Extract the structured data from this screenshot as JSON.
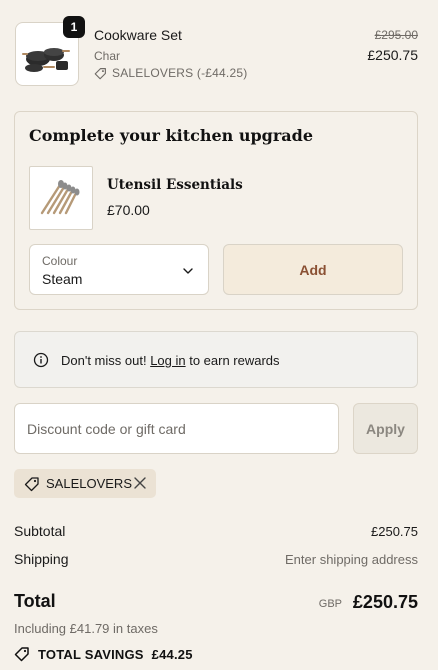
{
  "product": {
    "quantity": "1",
    "name": "Cookware Set",
    "variant": "Char",
    "discount_line": "SALELOVERS (-£44.25)",
    "original_price": "£295.00",
    "price": "£250.75",
    "image_icon": "cookware-image"
  },
  "upsell": {
    "title": "Complete your kitchen upgrade",
    "name": "Utensil Essentials",
    "price": "£70.00",
    "select_label": "Colour",
    "select_value": "Steam",
    "add_label": "Add",
    "image_icon": "utensils-image"
  },
  "notice": {
    "prefix": "Don't miss out! ",
    "link": "Log in",
    "suffix": " to earn rewards",
    "icon": "info-icon"
  },
  "discount": {
    "placeholder": "Discount code or gift card",
    "apply_label": "Apply",
    "applied_code": "SALELOVERS"
  },
  "totals": {
    "subtotal_label": "Subtotal",
    "subtotal_value": "£250.75",
    "shipping_label": "Shipping",
    "shipping_value": "Enter shipping address",
    "total_label": "Total",
    "currency": "GBP",
    "total_value": "£250.75",
    "tax_line": "Including £41.79 in taxes",
    "savings_label": "TOTAL SAVINGS",
    "savings_value": "£44.25"
  },
  "colors": {
    "background": "#f5f1ea",
    "accent": "#8a5033",
    "chip": "#ebe2d4"
  }
}
